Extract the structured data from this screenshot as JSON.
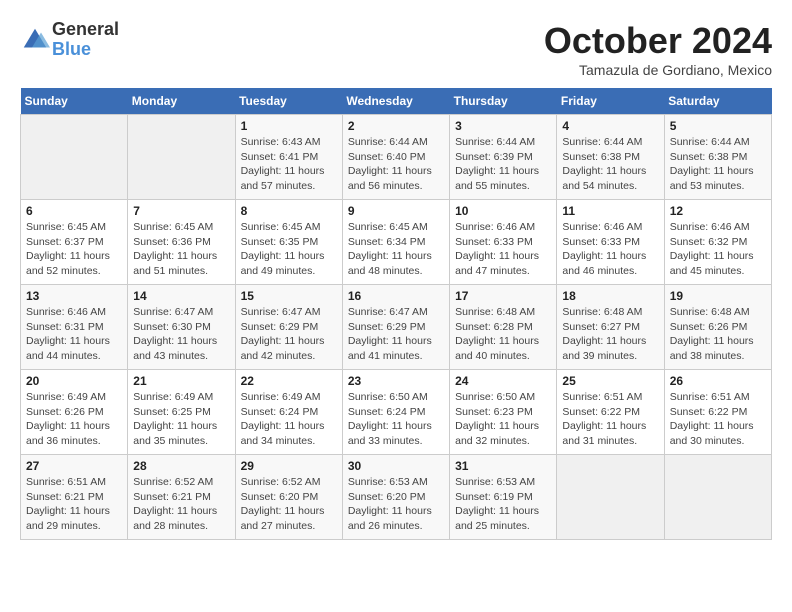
{
  "logo": {
    "general": "General",
    "blue": "Blue"
  },
  "title": "October 2024",
  "subtitle": "Tamazula de Gordiano, Mexico",
  "days_of_week": [
    "Sunday",
    "Monday",
    "Tuesday",
    "Wednesday",
    "Thursday",
    "Friday",
    "Saturday"
  ],
  "weeks": [
    [
      {
        "day": "",
        "info": ""
      },
      {
        "day": "",
        "info": ""
      },
      {
        "day": "1",
        "info": "Sunrise: 6:43 AM\nSunset: 6:41 PM\nDaylight: 11 hours and 57 minutes."
      },
      {
        "day": "2",
        "info": "Sunrise: 6:44 AM\nSunset: 6:40 PM\nDaylight: 11 hours and 56 minutes."
      },
      {
        "day": "3",
        "info": "Sunrise: 6:44 AM\nSunset: 6:39 PM\nDaylight: 11 hours and 55 minutes."
      },
      {
        "day": "4",
        "info": "Sunrise: 6:44 AM\nSunset: 6:38 PM\nDaylight: 11 hours and 54 minutes."
      },
      {
        "day": "5",
        "info": "Sunrise: 6:44 AM\nSunset: 6:38 PM\nDaylight: 11 hours and 53 minutes."
      }
    ],
    [
      {
        "day": "6",
        "info": "Sunrise: 6:45 AM\nSunset: 6:37 PM\nDaylight: 11 hours and 52 minutes."
      },
      {
        "day": "7",
        "info": "Sunrise: 6:45 AM\nSunset: 6:36 PM\nDaylight: 11 hours and 51 minutes."
      },
      {
        "day": "8",
        "info": "Sunrise: 6:45 AM\nSunset: 6:35 PM\nDaylight: 11 hours and 49 minutes."
      },
      {
        "day": "9",
        "info": "Sunrise: 6:45 AM\nSunset: 6:34 PM\nDaylight: 11 hours and 48 minutes."
      },
      {
        "day": "10",
        "info": "Sunrise: 6:46 AM\nSunset: 6:33 PM\nDaylight: 11 hours and 47 minutes."
      },
      {
        "day": "11",
        "info": "Sunrise: 6:46 AM\nSunset: 6:33 PM\nDaylight: 11 hours and 46 minutes."
      },
      {
        "day": "12",
        "info": "Sunrise: 6:46 AM\nSunset: 6:32 PM\nDaylight: 11 hours and 45 minutes."
      }
    ],
    [
      {
        "day": "13",
        "info": "Sunrise: 6:46 AM\nSunset: 6:31 PM\nDaylight: 11 hours and 44 minutes."
      },
      {
        "day": "14",
        "info": "Sunrise: 6:47 AM\nSunset: 6:30 PM\nDaylight: 11 hours and 43 minutes."
      },
      {
        "day": "15",
        "info": "Sunrise: 6:47 AM\nSunset: 6:29 PM\nDaylight: 11 hours and 42 minutes."
      },
      {
        "day": "16",
        "info": "Sunrise: 6:47 AM\nSunset: 6:29 PM\nDaylight: 11 hours and 41 minutes."
      },
      {
        "day": "17",
        "info": "Sunrise: 6:48 AM\nSunset: 6:28 PM\nDaylight: 11 hours and 40 minutes."
      },
      {
        "day": "18",
        "info": "Sunrise: 6:48 AM\nSunset: 6:27 PM\nDaylight: 11 hours and 39 minutes."
      },
      {
        "day": "19",
        "info": "Sunrise: 6:48 AM\nSunset: 6:26 PM\nDaylight: 11 hours and 38 minutes."
      }
    ],
    [
      {
        "day": "20",
        "info": "Sunrise: 6:49 AM\nSunset: 6:26 PM\nDaylight: 11 hours and 36 minutes."
      },
      {
        "day": "21",
        "info": "Sunrise: 6:49 AM\nSunset: 6:25 PM\nDaylight: 11 hours and 35 minutes."
      },
      {
        "day": "22",
        "info": "Sunrise: 6:49 AM\nSunset: 6:24 PM\nDaylight: 11 hours and 34 minutes."
      },
      {
        "day": "23",
        "info": "Sunrise: 6:50 AM\nSunset: 6:24 PM\nDaylight: 11 hours and 33 minutes."
      },
      {
        "day": "24",
        "info": "Sunrise: 6:50 AM\nSunset: 6:23 PM\nDaylight: 11 hours and 32 minutes."
      },
      {
        "day": "25",
        "info": "Sunrise: 6:51 AM\nSunset: 6:22 PM\nDaylight: 11 hours and 31 minutes."
      },
      {
        "day": "26",
        "info": "Sunrise: 6:51 AM\nSunset: 6:22 PM\nDaylight: 11 hours and 30 minutes."
      }
    ],
    [
      {
        "day": "27",
        "info": "Sunrise: 6:51 AM\nSunset: 6:21 PM\nDaylight: 11 hours and 29 minutes."
      },
      {
        "day": "28",
        "info": "Sunrise: 6:52 AM\nSunset: 6:21 PM\nDaylight: 11 hours and 28 minutes."
      },
      {
        "day": "29",
        "info": "Sunrise: 6:52 AM\nSunset: 6:20 PM\nDaylight: 11 hours and 27 minutes."
      },
      {
        "day": "30",
        "info": "Sunrise: 6:53 AM\nSunset: 6:20 PM\nDaylight: 11 hours and 26 minutes."
      },
      {
        "day": "31",
        "info": "Sunrise: 6:53 AM\nSunset: 6:19 PM\nDaylight: 11 hours and 25 minutes."
      },
      {
        "day": "",
        "info": ""
      },
      {
        "day": "",
        "info": ""
      }
    ]
  ]
}
